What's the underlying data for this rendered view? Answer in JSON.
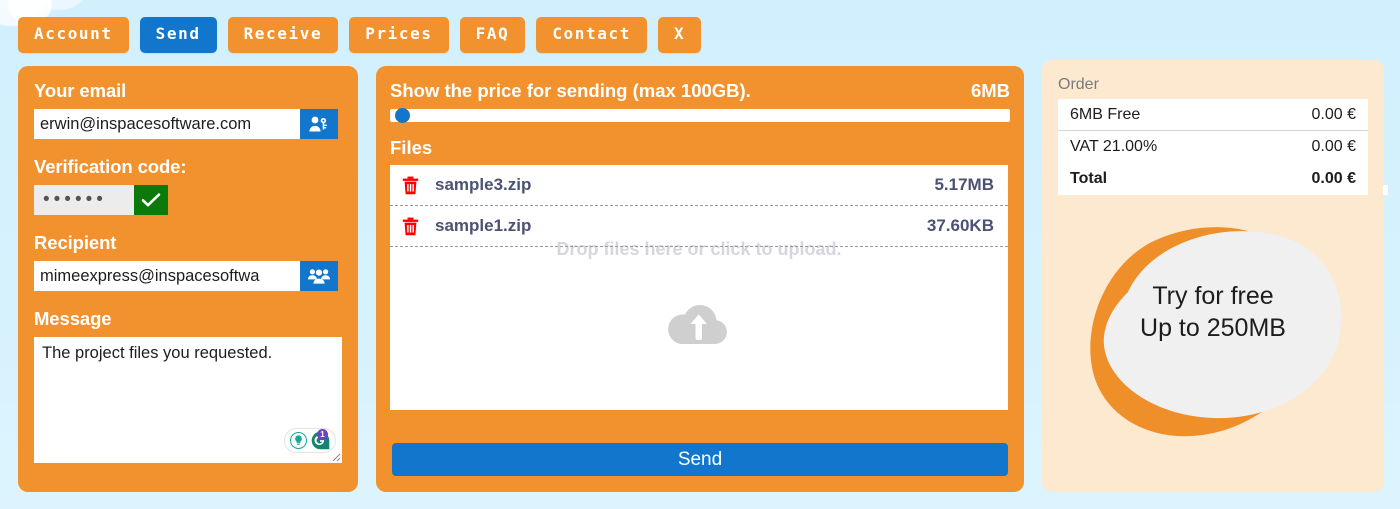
{
  "nav": {
    "items": [
      {
        "label": "Account",
        "active": false,
        "name": "nav-account"
      },
      {
        "label": "Send",
        "active": true,
        "name": "nav-send"
      },
      {
        "label": "Receive",
        "active": false,
        "name": "nav-receive"
      },
      {
        "label": "Prices",
        "active": false,
        "name": "nav-prices"
      },
      {
        "label": "FAQ",
        "active": false,
        "name": "nav-faq"
      },
      {
        "label": "Contact",
        "active": false,
        "name": "nav-contact"
      },
      {
        "label": "X",
        "active": false,
        "name": "nav-close"
      }
    ]
  },
  "form": {
    "email_label": "Your email",
    "email_value": "erwin@inspacesoftware.com",
    "email_icon": "person-key-icon",
    "verification_label": "Verification code:",
    "verification_value": "••••••",
    "verification_confirm_icon": "check-icon",
    "recipient_label": "Recipient",
    "recipient_value": "mimeexpress@inspacesoftwa",
    "recipient_icon": "contacts-group-icon",
    "message_label": "Message",
    "message_value": "The project files you requested.",
    "grammarly": {
      "assistant_icon": "lightbulb-icon",
      "brand_icon": "grammarly-g-icon",
      "badge_count": "1"
    }
  },
  "price": {
    "title": "Show the price for sending (max 100GB).",
    "total_size": "6MB",
    "slider_value_pct": 0,
    "slider_max_label": "100GB"
  },
  "files": {
    "section_label": "Files",
    "drop_hint": "Drop files here or click to upload.",
    "upload_icon": "cloud-upload-icon",
    "delete_icon": "trash-icon",
    "items": [
      {
        "name": "sample3.zip",
        "size": "5.17MB"
      },
      {
        "name": "sample1.zip",
        "size": "37.60KB"
      }
    ]
  },
  "actions": {
    "send_label": "Send"
  },
  "order": {
    "title": "Order",
    "rows": [
      {
        "key": "6MB Free",
        "value": "0.00 €",
        "total": false
      },
      {
        "key": "VAT 21.00%",
        "value": "0.00 €",
        "total": false
      },
      {
        "key": "Total",
        "value": "0.00 €",
        "total": true
      }
    ]
  },
  "promo": {
    "line1": "Try for free",
    "line2": "Up to 250MB"
  },
  "colors": {
    "brand_orange": "#f2922e",
    "accent_blue": "#1277cc",
    "page_background": "#d4f1fd",
    "order_background": "#fde9cf",
    "success_green": "#0b7a0b",
    "danger_red": "#ff0000",
    "file_text": "#4b5272",
    "promo_blob": "#ef8f2a",
    "promo_card": "#f0f0f0"
  }
}
